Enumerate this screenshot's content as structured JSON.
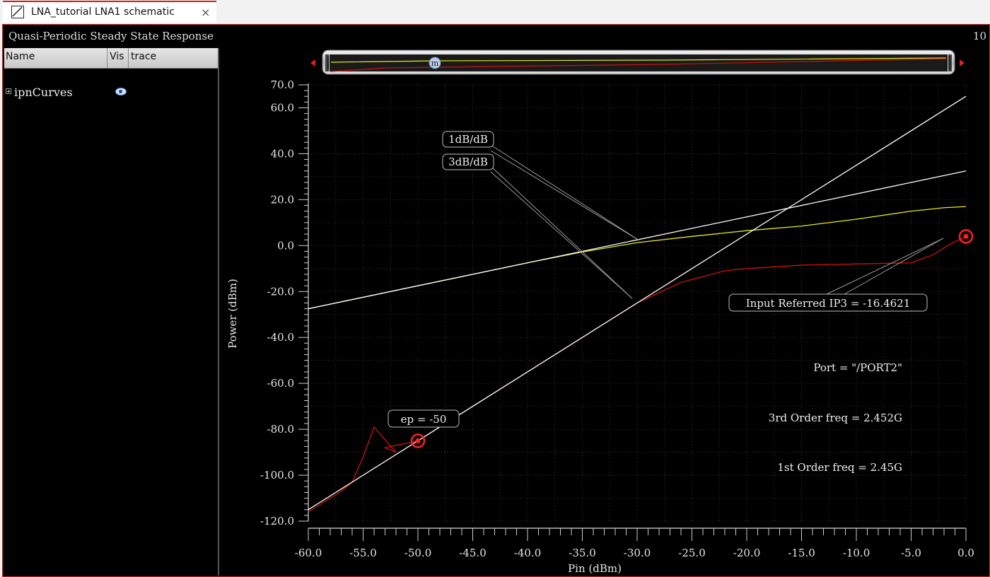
{
  "tab": {
    "title": "LNA_tutorial LNA1 schematic",
    "close_glyph": "×",
    "icon": "schematic-icon"
  },
  "window": {
    "title": "Quasi-Periodic Steady State Response",
    "number": "10"
  },
  "panel": {
    "headers": [
      "Name",
      "Vis",
      "trace"
    ],
    "items": [
      {
        "label": "ipnCurves",
        "visible": true,
        "icon": "eye-icon"
      }
    ]
  },
  "chart_data": {
    "type": "line",
    "xlabel": "Pin (dBm)",
    "ylabel": "Power (dBm)",
    "xlim": [
      -60,
      0
    ],
    "ylim": [
      -120,
      70
    ],
    "x_ticks": [
      "-60.0",
      "-55.0",
      "-50.0",
      "-45.0",
      "-40.0",
      "-35.0",
      "-30.0",
      "-25.0",
      "-20.0",
      "-15.0",
      "-10.0",
      "-5.0",
      "0.0"
    ],
    "y_ticks": [
      "70.0",
      "60.0",
      "40.0",
      "20.0",
      "0.0",
      "-20.0",
      "-40.0",
      "-60.0",
      "-80.0",
      "-100.0",
      "-120.0"
    ],
    "y_tick_values": [
      70,
      60,
      40,
      20,
      0,
      -20,
      -40,
      -60,
      -80,
      -100,
      -120
    ],
    "x_tick_values": [
      -60,
      -55,
      -50,
      -45,
      -40,
      -35,
      -30,
      -25,
      -20,
      -15,
      -10,
      -5,
      0
    ],
    "grid": true,
    "colors": {
      "first_order": "#e8e81a",
      "third_order": "#cc1111",
      "extrapolation": "#ffffff",
      "marker": "#ff2020"
    },
    "series": [
      {
        "id": "first",
        "color": "#e8e81a",
        "x": [
          -60,
          -55,
          -50,
          -45,
          -40,
          -35,
          -30,
          -25,
          -20,
          -15,
          -10,
          -5,
          -2,
          0
        ],
        "y": [
          -27.5,
          -22.5,
          -17.5,
          -12.5,
          -7.5,
          -2.8,
          1.3,
          4.0,
          6.5,
          8.5,
          11.5,
          15.0,
          16.5,
          17.0
        ]
      },
      {
        "id": "third",
        "color": "#cc1111",
        "x": [
          -60,
          -57,
          -56,
          -55,
          -54,
          -52,
          -53,
          -50,
          -45,
          -40,
          -35,
          -30,
          -26,
          -24,
          -22,
          -20,
          -15,
          -10,
          -5,
          -3,
          -1.5,
          0
        ],
        "y": [
          -116,
          -107,
          -103,
          -92,
          -79,
          -90,
          -88,
          -85,
          -70,
          -55,
          -40,
          -25,
          -16,
          -13.5,
          -11,
          -10,
          -8.5,
          -8,
          -7.5,
          -4,
          0.5,
          4
        ]
      },
      {
        "id": "slope1",
        "color": "#ffffff",
        "x": [
          -60,
          0
        ],
        "y": [
          -27.5,
          32.5
        ]
      },
      {
        "id": "slope3",
        "color": "#ffffff",
        "x": [
          -60,
          0
        ],
        "y": [
          -115,
          65
        ]
      }
    ],
    "annotations": {
      "slope1_label": "1dB/dB",
      "slope3_label": "3dB/dB",
      "ep_label": "ep = -50",
      "ip3_label": "Input Referred IP3 = -16.4621",
      "port_label": "Port = \"/PORT2\"",
      "third_freq_label": "3rd Order freq = 2.452G",
      "first_freq_label": "1st Order freq = 2.45G"
    },
    "markers": [
      {
        "x": -50,
        "y": -85
      },
      {
        "x": 0,
        "y": 4
      }
    ]
  },
  "scroll": {
    "marker_label": "m"
  }
}
